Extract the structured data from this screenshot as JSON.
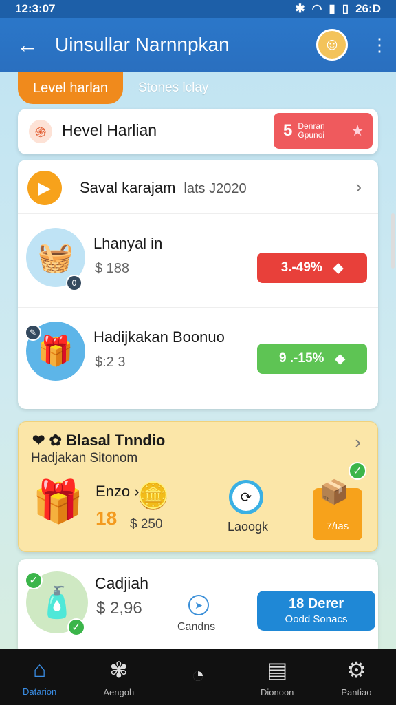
{
  "status": {
    "time": "12:3:07",
    "right": "26:D",
    "icons": [
      "bluetooth-icon",
      "wifi-icon",
      "signal-icon",
      "battery-icon"
    ]
  },
  "appbar": {
    "title": "Uinsullar Narnnpkan"
  },
  "tabs": {
    "active": "Level harlan",
    "inactive": "Stones lclay"
  },
  "header": {
    "title": "Hevel Harlian",
    "badge_num": "5",
    "badge_line1": "Denran",
    "badge_line2": "Gpunoi"
  },
  "saval": {
    "title": "Saval karajam",
    "sub": "lats J2020"
  },
  "items": [
    {
      "title": "Lhanyal in",
      "price": "$ 188",
      "pill": "3.-49%",
      "pill_color": "#e8403a"
    },
    {
      "title": "Hadijkakan Boonuo",
      "price": "$:2 3",
      "pill": "9 .-15%",
      "pill_color": "#5ec454"
    }
  ],
  "promo": {
    "title": "❤ ✿ Blasal Tnndio",
    "sub": "Hadjakan Sitonom",
    "name": "Enzo ›",
    "num": "18",
    "price": "$ 250",
    "clock_label": "Laoogk",
    "tag": "7/ıas"
  },
  "bottom": {
    "title": "Cadjiah",
    "price": "$  2,96",
    "label": "Candns",
    "btn_a": "18 Derer",
    "btn_b": "Oodd Sonacs"
  },
  "nav": [
    {
      "label": "Datarion",
      "icon": "home-icon"
    },
    {
      "label": "Aengoh",
      "icon": "butterfly-icon"
    },
    {
      "label": "",
      "icon": "timer-icon"
    },
    {
      "label": "Dionoon",
      "icon": "document-icon"
    },
    {
      "label": "Pantiao",
      "icon": "settings-icon"
    }
  ],
  "colors": {
    "primary": "#2a6fbf",
    "accent": "#f08a1c",
    "red": "#e8403a",
    "green": "#5ec454"
  }
}
